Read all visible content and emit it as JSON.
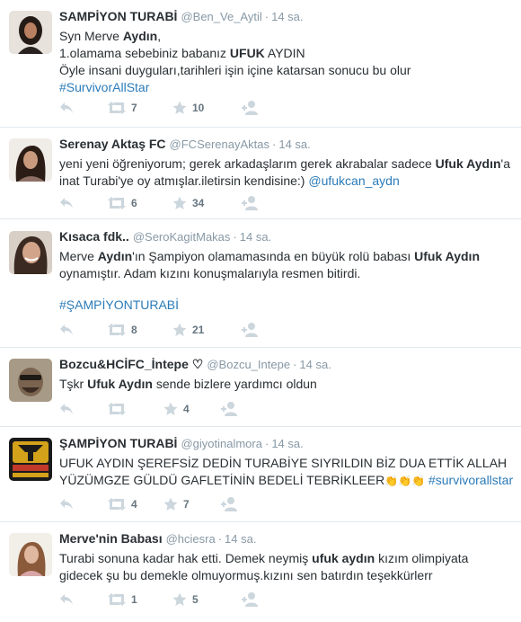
{
  "colors": {
    "icon": "#ccd6dd",
    "link": "#2b7bb9",
    "meta": "#8899a6",
    "divider": "#e1e8ed"
  },
  "tweets": [
    {
      "fullname": "SAMPİYON TURABİ",
      "username": "@Ben_Ve_Aytil",
      "time": "14 sa.",
      "l1a": "Syn Merve ",
      "l1b": "Aydın",
      "l1c": ",",
      "l2a": "1.olamama sebebiniz babanız ",
      "l2b": "UFUK",
      "l2c": " AYDIN",
      "l3": "Öyle insani duyguları,tarihleri işin içine katarsan sonucu bu olur",
      "hashtag": "#SurvivorAllStar",
      "retweets": "7",
      "likes": "10"
    },
    {
      "fullname": "Serenay Aktaş FC",
      "username": "@FCSerenayAktas",
      "time": "14 sa.",
      "l1a": "yeni yeni öğreniyorum; gerek arkadaşlarım gerek akrabalar sadece ",
      "l1b": "Ufuk Aydın",
      "l1c": "'a",
      "l2a": "inat Turabi'ye oy atmışlar.iletirsin kendisine:) ",
      "mention": "@ufukcan_aydn",
      "retweets": "6",
      "likes": "34"
    },
    {
      "fullname": "Kısaca fdk..",
      "username": "@SeroKagitMakas",
      "time": "14 sa.",
      "l1a": "Merve ",
      "l1b": "Aydın",
      "l1c": "'ın Şampiyon olamamasında en büyük rolü babası ",
      "l1d": "Ufuk Aydın",
      "l2a": "oynamıştır. Adam kızını konuşmalarıyla resmen bitirdi.",
      "hashtag": "#ŞAMPİYONTURABİ",
      "retweets": "8",
      "likes": "21"
    },
    {
      "fullname": "Bozcu&HCİFC_İntepe ♡",
      "username": "@Bozcu_Intepe",
      "time": "14 sa.",
      "l1a": "Tşkr ",
      "l1b": "Ufuk Aydın",
      "l1c": " sende bizlere yardımcı oldun",
      "retweets": "",
      "likes": "4"
    },
    {
      "fullname": "ŞAMPİYON TURABİ",
      "username": "@giyotinalmora",
      "time": "14 sa.",
      "l1a": "UFUK AYDIN ŞEREFSİZ DEDİN TURABİYE SIYRILDIN BİZ DUA ETTİK ALLAH",
      "l2a": "YÜZÜMGZE GÜLDÜ GAFLETİNİN BEDELİ TEBRİKLEER",
      "emoji": "👏👏👏",
      "hashtag": "#survivorallstar",
      "retweets": "4",
      "likes": "7"
    },
    {
      "fullname": "Merve'nin Babası",
      "username": "@hciesra",
      "time": "14 sa.",
      "l1a": "Turabi sonuna kadar hak etti. Demek neymiş ",
      "l1b": "ufuk aydın",
      "l1c": " kızım olimpiyata",
      "l2a": "gidecek şu bu demekle olmuyormuş.kızını sen batırdın teşekkürlerr",
      "retweets": "1",
      "likes": "5"
    }
  ]
}
